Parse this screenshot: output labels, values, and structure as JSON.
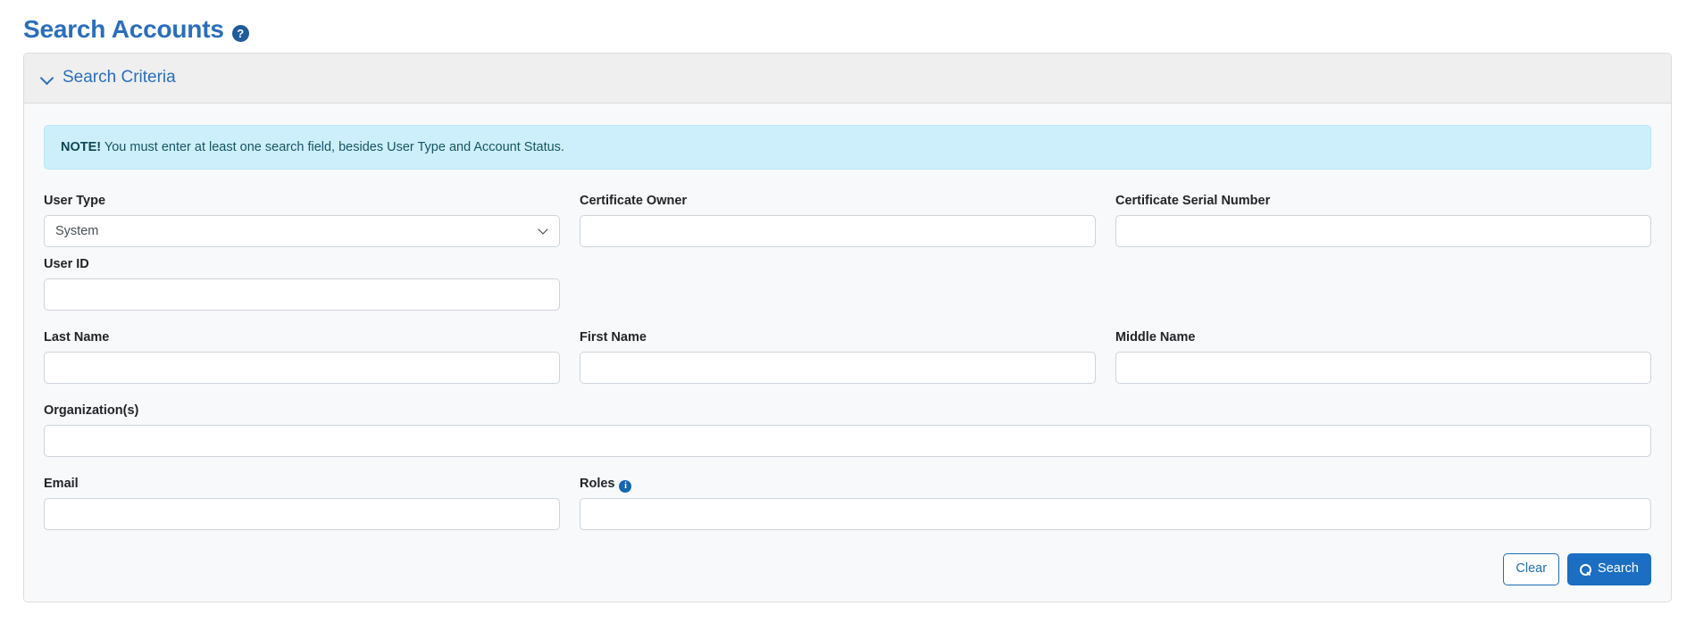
{
  "page": {
    "title": "Search Accounts",
    "help_icon": "question-mark-icon",
    "help_glyph": "?"
  },
  "panel": {
    "header_title": "Search Criteria",
    "collapse_icon": "chevron-down-icon"
  },
  "note": {
    "prefix": "NOTE!",
    "text": " You must enter at least one search field, besides User Type and Account Status."
  },
  "form": {
    "user_type": {
      "label": "User Type",
      "value": "System",
      "options": [
        "System"
      ],
      "arrow_icon": "chevron-down-icon"
    },
    "certificate_owner": {
      "label": "Certificate Owner",
      "value": "",
      "placeholder": ""
    },
    "certificate_serial_number": {
      "label": "Certificate Serial Number",
      "value": "",
      "placeholder": ""
    },
    "user_id": {
      "label": "User ID",
      "value": "",
      "placeholder": ""
    },
    "last_name": {
      "label": "Last Name",
      "value": "",
      "placeholder": ""
    },
    "first_name": {
      "label": "First Name",
      "value": "",
      "placeholder": ""
    },
    "middle_name": {
      "label": "Middle Name",
      "value": "",
      "placeholder": ""
    },
    "organizations": {
      "label": "Organization(s)",
      "value": "",
      "placeholder": ""
    },
    "email": {
      "label": "Email",
      "value": "",
      "placeholder": ""
    },
    "roles": {
      "label": "Roles",
      "value": "",
      "placeholder": "",
      "info_icon": "info-circle-icon",
      "info_glyph": "i"
    }
  },
  "actions": {
    "clear_label": "Clear",
    "search_label": "Search",
    "search_icon": "magnifier-icon"
  },
  "colors": {
    "title_blue": "#2a6ebb",
    "primary_blue": "#1b6ec2",
    "note_bg": "#cdeffb",
    "note_text": "#155464",
    "panel_header_bg": "#efefef",
    "panel_body_bg": "#f8f9fa",
    "border": "#dcdcdc",
    "input_border": "#ced4da"
  }
}
